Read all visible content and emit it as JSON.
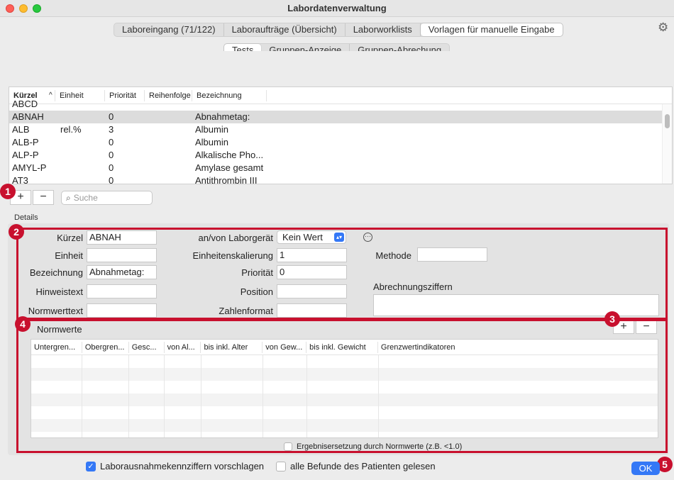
{
  "window": {
    "title": "Labordatenverwaltung"
  },
  "main_tabs": [
    {
      "label": "Laboreingang (71/122)"
    },
    {
      "label": "Laboraufträge (Übersicht)"
    },
    {
      "label": "Laborworklists"
    },
    {
      "label": "Vorlagen für manuelle Eingabe"
    }
  ],
  "sub_tabs": [
    {
      "label": "Tests"
    },
    {
      "label": "Gruppen-Anzeige"
    },
    {
      "label": "Gruppen-Abrechung"
    }
  ],
  "tests_table": {
    "columns": [
      "Kürzel",
      "^",
      "Einheit",
      "Priorität",
      "Reihenfolge",
      "Bezeichnung"
    ],
    "rows": [
      {
        "kuerzel": "ABCD",
        "einheit": "",
        "prioritaet": "",
        "bezeichnung": ""
      },
      {
        "kuerzel": "ABNAH",
        "einheit": "",
        "prioritaet": "0",
        "bezeichnung": "Abnahmetag:"
      },
      {
        "kuerzel": "ALB",
        "einheit": "rel.%",
        "prioritaet": "3",
        "bezeichnung": "Albumin"
      },
      {
        "kuerzel": "ALB-P",
        "einheit": "",
        "prioritaet": "0",
        "bezeichnung": "Albumin"
      },
      {
        "kuerzel": "ALP-P",
        "einheit": "",
        "prioritaet": "0",
        "bezeichnung": "Alkalische Pho..."
      },
      {
        "kuerzel": "AMYL-P",
        "einheit": "",
        "prioritaet": "0",
        "bezeichnung": "Amylase gesamt"
      },
      {
        "kuerzel": "AT3",
        "einheit": "",
        "prioritaet": "0",
        "bezeichnung": "Antithrombin III"
      }
    ]
  },
  "table_controls": {
    "add": "+",
    "remove": "−",
    "search_placeholder": "Suche"
  },
  "details": {
    "section_label": "Details",
    "kuerzel_label": "Kürzel",
    "kuerzel_value": "ABNAH",
    "einheit_label": "Einheit",
    "einheit_value": "",
    "bezeichnung_label": "Bezeichnung",
    "bezeichnung_value": "Abnahmetag:",
    "hinweistext_label": "Hinweistext",
    "hinweistext_value": "",
    "normwerttext_label": "Normwerttext",
    "normwerttext_value": "",
    "laborgeraet_label": "an/von Laborgerät",
    "laborgeraet_value": "Kein Wert",
    "skalierung_label": "Einheitenskalierung",
    "skalierung_value": "1",
    "prioritaet_label": "Priorität",
    "prioritaet_value": "0",
    "position_label": "Position",
    "position_value": "",
    "zahlenformat_label": "Zahlenformat",
    "zahlenformat_value": "",
    "methode_label": "Methode",
    "methode_value": "",
    "abrechnung_label": "Abrechnungsziffern",
    "abrechnung_value": ""
  },
  "normwerte": {
    "title": "Normwerte",
    "add": "+",
    "remove": "−",
    "columns": [
      "Untergren...",
      "Obergren...",
      "Gesc...",
      "von Al...",
      "bis inkl. Alter",
      "von Gew...",
      "bis inkl. Gewicht",
      "Grenzwertindikatoren"
    ],
    "ergebnis_checkbox": "Ergebnisersetzung durch Normwerte (z.B. <1.0)",
    "ergebnis_checked": false
  },
  "footer": {
    "ausnahme_label": "Laborausnahmekennziffern vorschlagen",
    "ausnahme_checked": true,
    "befunde_label": "alle Befunde des Patienten gelesen",
    "befunde_checked": false,
    "ok_label": "OK"
  },
  "annotations": [
    "1",
    "2",
    "3",
    "4",
    "5"
  ],
  "colors": {
    "highlight": "#c8102e",
    "accent": "#3478f6"
  }
}
